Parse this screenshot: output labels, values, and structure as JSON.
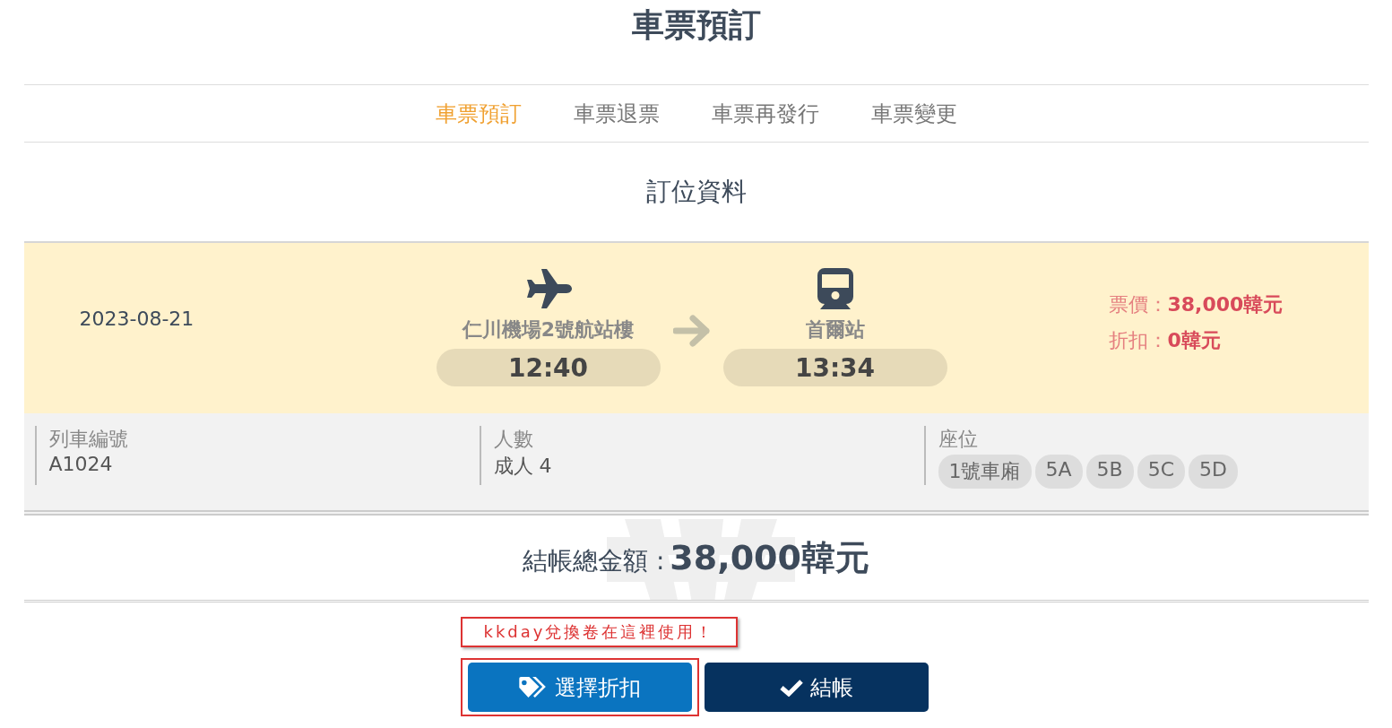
{
  "page_title": "車票預訂",
  "tabs": [
    {
      "label": "車票預訂",
      "selected": true
    },
    {
      "label": "車票退票",
      "selected": false
    },
    {
      "label": "車票再發行",
      "selected": false
    },
    {
      "label": "車票變更",
      "selected": false
    }
  ],
  "section_title": "訂位資料",
  "trip": {
    "date": "2023-08-21",
    "departure": {
      "kind": "plane",
      "station": "仁川機場2號航站樓",
      "time": "12:40"
    },
    "arrival": {
      "kind": "train",
      "station": "首爾站",
      "time": "13:34"
    },
    "price": [
      {
        "label": "票價：",
        "value": "38,000韓元"
      },
      {
        "label": "折扣：",
        "value": "0韓元"
      }
    ]
  },
  "details": [
    {
      "label": "列車編號",
      "value": "A1024"
    },
    {
      "label": "人數",
      "value": "成人 4"
    },
    {
      "label": "座位",
      "seats": [
        "1號車廂",
        "5A",
        "5B",
        "5C",
        "5D"
      ]
    }
  ],
  "total": {
    "label": "結帳總金額 :",
    "value": "38,000韓元"
  },
  "annotation": "kkday兌換卷在這裡使用！",
  "buttons": [
    {
      "kind": "discount",
      "label": "選擇折扣",
      "highlighted": true
    },
    {
      "kind": "checkout",
      "label": "結帳",
      "highlighted": false
    }
  ]
}
